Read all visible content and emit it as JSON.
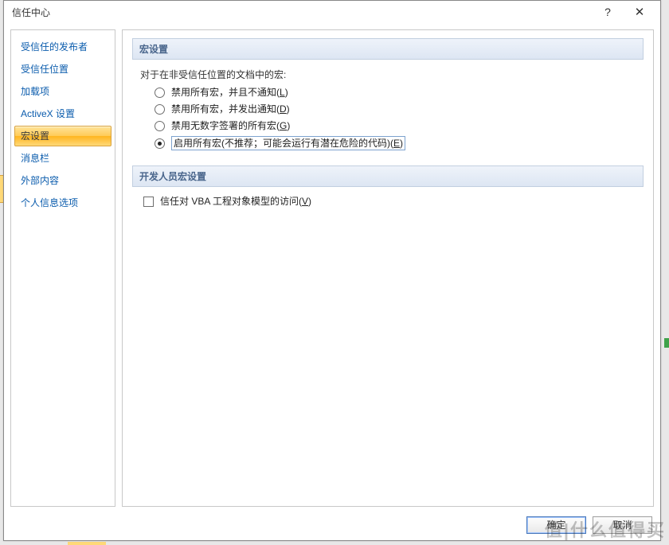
{
  "window": {
    "title": "信任中心",
    "help_symbol": "?",
    "close_symbol": "✕"
  },
  "sidebar": {
    "items": [
      {
        "label": "受信任的发布者",
        "selected": false
      },
      {
        "label": "受信任位置",
        "selected": false
      },
      {
        "label": "加载项",
        "selected": false
      },
      {
        "label": "ActiveX 设置",
        "selected": false
      },
      {
        "label": "宏设置",
        "selected": true
      },
      {
        "label": "消息栏",
        "selected": false
      },
      {
        "label": "外部内容",
        "selected": false
      },
      {
        "label": "个人信息选项",
        "selected": false
      }
    ]
  },
  "content": {
    "section1": {
      "header": "宏设置",
      "intro": "对于在非受信任位置的文档中的宏:",
      "options": [
        {
          "label_pre": "禁用所有宏，并且不通知(",
          "mnemonic": "L",
          "label_post": ")",
          "checked": false
        },
        {
          "label_pre": "禁用所有宏，并发出通知(",
          "mnemonic": "D",
          "label_post": ")",
          "checked": false
        },
        {
          "label_pre": "禁用无数字签署的所有宏(",
          "mnemonic": "G",
          "label_post": ")",
          "checked": false
        },
        {
          "label_pre": "启用所有宏(不推荐；可能会运行有潜在危险的代码)(",
          "mnemonic": "E",
          "label_post": ")",
          "checked": true,
          "boxed": true
        }
      ]
    },
    "section2": {
      "header": "开发人员宏设置",
      "checkbox": {
        "label_pre": "信任对 VBA 工程对象模型的访问(",
        "mnemonic": "V",
        "label_post": ")",
        "checked": false
      }
    }
  },
  "buttons": {
    "ok": "确定",
    "cancel": "取消"
  },
  "watermark": "值|什么值得买"
}
